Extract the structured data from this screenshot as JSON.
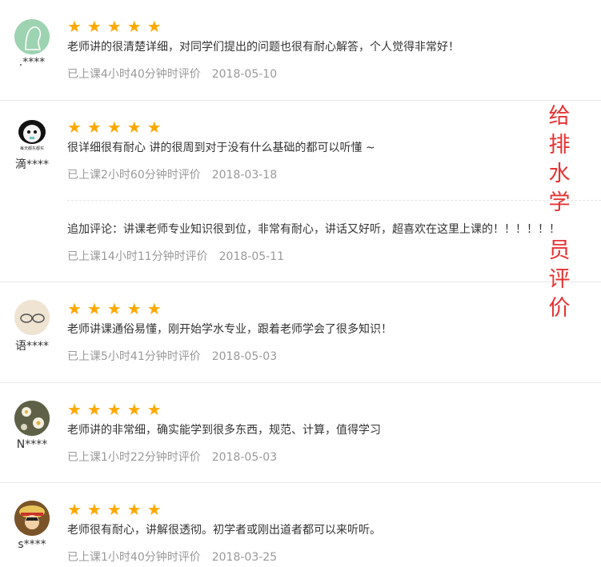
{
  "reviews": [
    {
      "username": ".****",
      "rating": 5,
      "content": "老师讲的很清楚详细，对同学们提出的问题也很有耐心解答，个人觉得非常好！",
      "meta": "已上课4小时40分钟时评价",
      "date": "2018-05-10"
    },
    {
      "username": "滴****",
      "rating": 5,
      "content": "很详细很有耐心 讲的很周到对于没有什么基础的都可以听懂 ~",
      "meta": "已上课2小时60分钟时评价",
      "date": "2018-03-18",
      "avatar_caption": "每天都东都买",
      "followup": {
        "content": "追加评论：讲课老师专业知识很到位，非常有耐心，讲话又好听，超喜欢在这里上课的！！！！！！",
        "meta": "已上课14小时11分钟时评价",
        "date": "2018-05-11"
      }
    },
    {
      "username": "语****",
      "rating": 5,
      "content": "老师讲课通俗易懂，刚开始学水专业，跟着老师学会了很多知识！",
      "meta": "已上课5小时41分钟时评价",
      "date": "2018-05-03"
    },
    {
      "username": "N****",
      "rating": 5,
      "content": "老师讲的非常细，确实能学到很多东西，规范、计算，值得学习",
      "meta": "已上课1小时22分钟时评价",
      "date": "2018-05-03"
    },
    {
      "username": "s****",
      "rating": 5,
      "content": "老师很有耐心，讲解很透彻。初学者或刚出道者都可以来听听。",
      "meta": "已上课1小时40分钟时评价",
      "date": "2018-03-25"
    }
  ],
  "banner": {
    "line1": "给排水学",
    "line2": "员评价"
  },
  "colors": {
    "star": "#ffa800",
    "banner": "#e53333",
    "meta": "#999999"
  }
}
